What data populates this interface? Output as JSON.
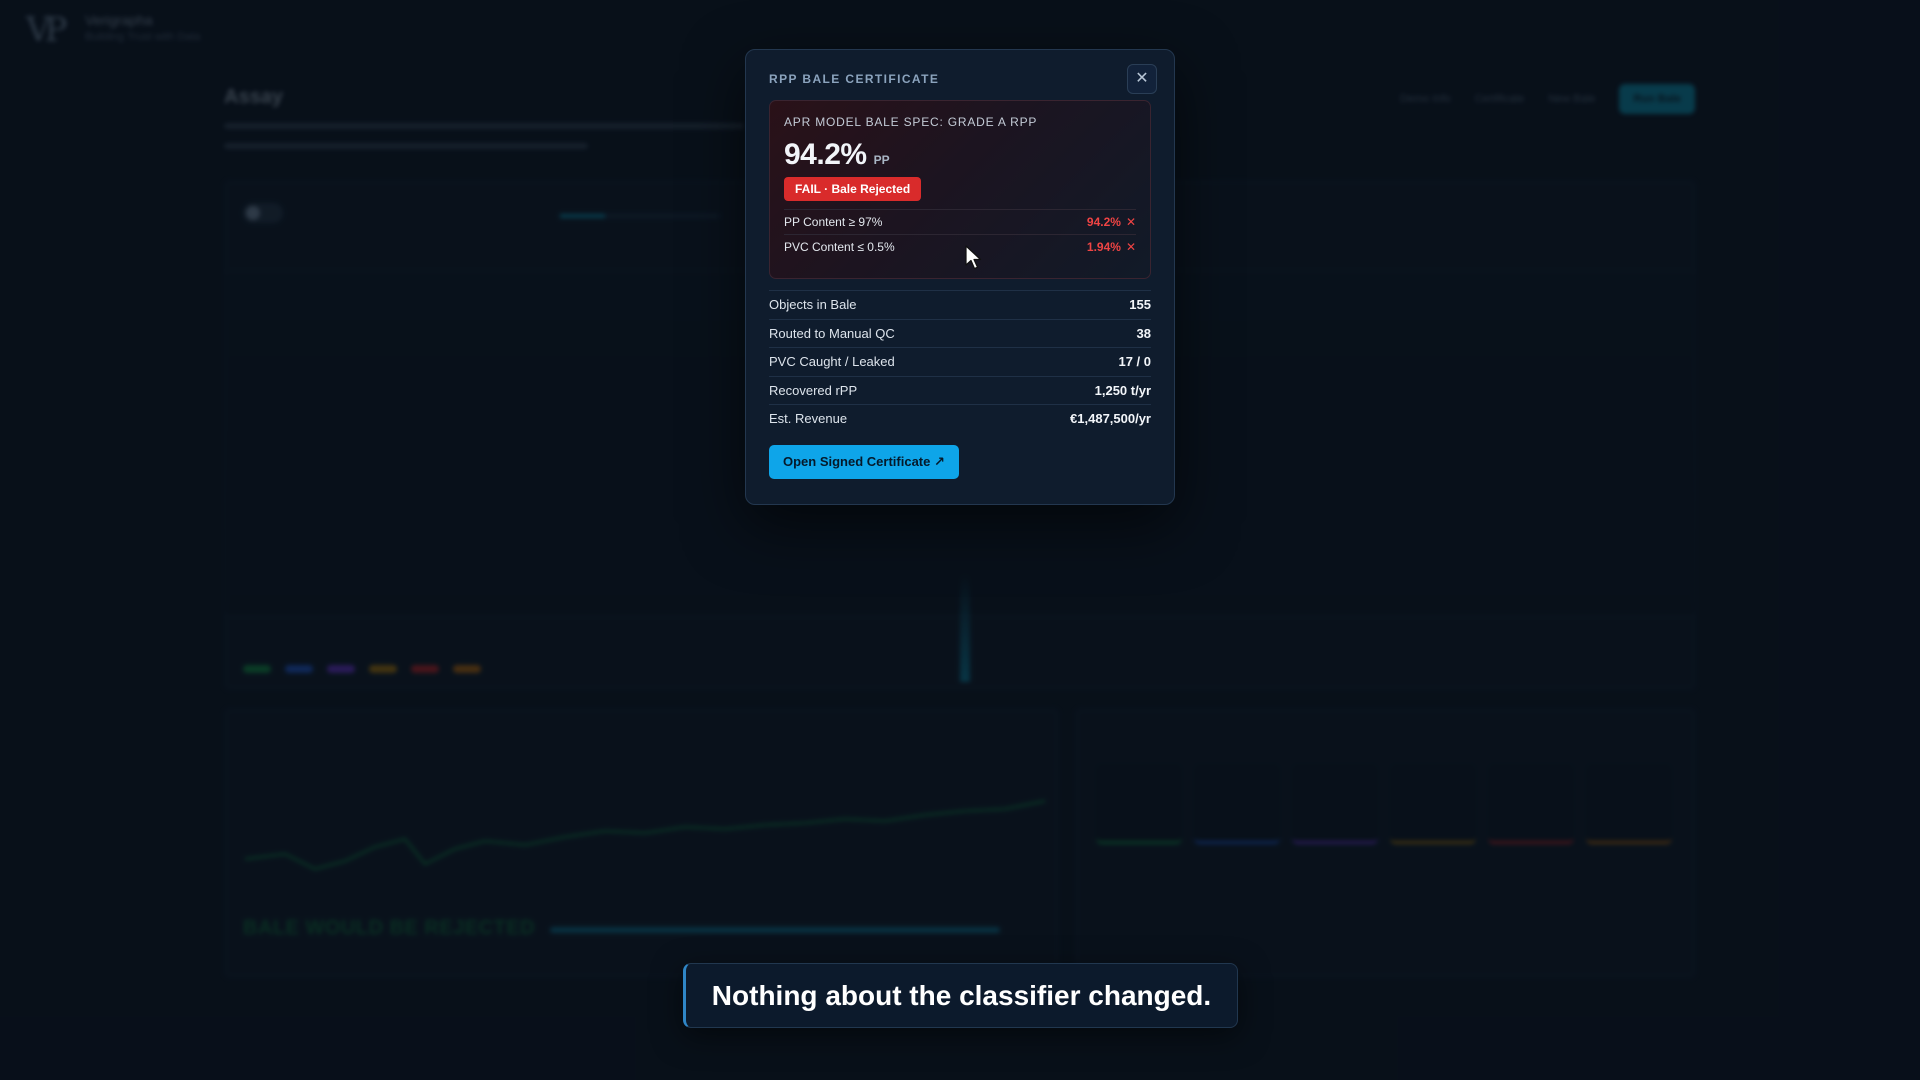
{
  "background": {
    "brand": {
      "name": "Verigrapha",
      "tagline": "Building Trust with Data"
    },
    "page_title": "Assay",
    "nav": [
      "Demo Info",
      "Certificate",
      "New Bale",
      "Run Bale"
    ],
    "reject_banner": "BALE WOULD BE REJECTED"
  },
  "modal": {
    "title": "RPP BALE CERTIFICATE",
    "spec_label": "APR MODEL BALE SPEC: GRADE A RPP",
    "purity_value": "94.2%",
    "purity_unit": "PP",
    "status_badge": "FAIL · Bale Rejected",
    "checks": [
      {
        "label": "PP Content ≥ 97%",
        "value": "94.2%"
      },
      {
        "label": "PVC Content ≤ 0.5%",
        "value": "1.94%"
      }
    ],
    "stats": [
      {
        "label": "Objects in Bale",
        "value": "155"
      },
      {
        "label": "Routed to Manual QC",
        "value": "38"
      },
      {
        "label": "PVC Caught / Leaked",
        "value": "17 / 0"
      },
      {
        "label": "Recovered rPP",
        "value": "1,250 t/yr"
      },
      {
        "label": "Est. Revenue",
        "value": "€1,487,500/yr"
      }
    ],
    "cert_button": "Open Signed Certificate ↗",
    "close_glyph": "✕"
  },
  "caption": "Nothing about the classifier changed.",
  "colors": {
    "accent": "#0ea5e9",
    "fail": "#d92b2b",
    "fail_text": "#ef4444",
    "modal_bg": "#0f1c2d",
    "page_bg": "#0b1420"
  }
}
